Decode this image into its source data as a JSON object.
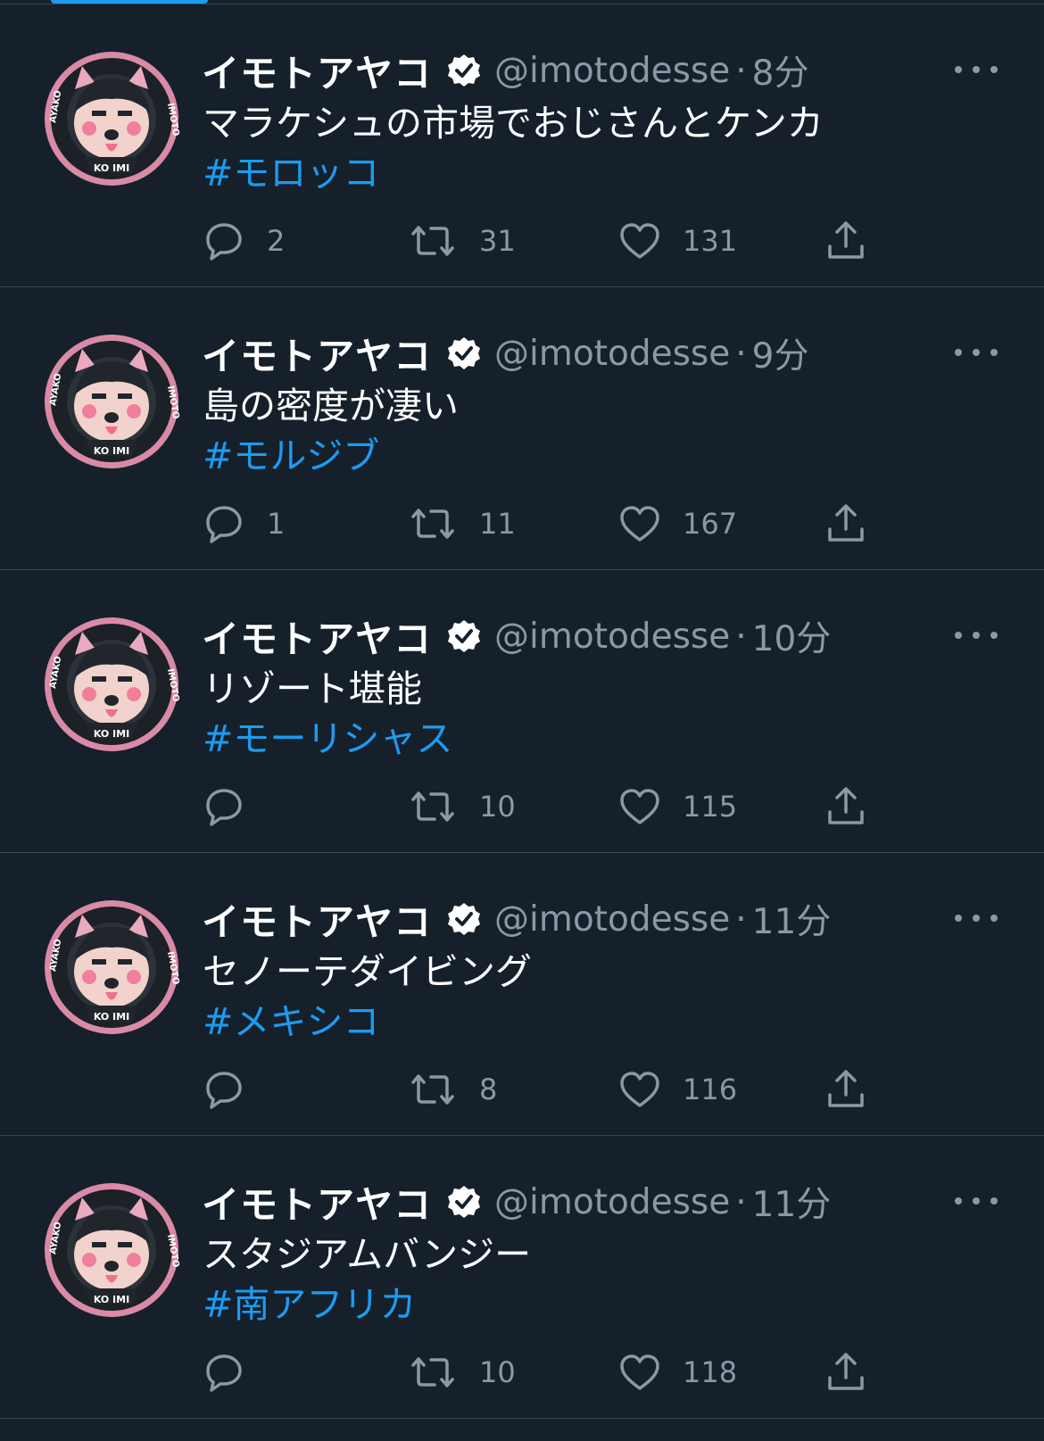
{
  "tweets": [
    {
      "name": "イモトアヤコ",
      "handle": "@imotodesse",
      "time": "8分",
      "text": "マラケシュの市場でおじさんとケンカ",
      "hashtag": "#モロッコ",
      "replies": "2",
      "retweets": "31",
      "likes": "131"
    },
    {
      "name": "イモトアヤコ",
      "handle": "@imotodesse",
      "time": "9分",
      "text": "島の密度が凄い",
      "hashtag": "#モルジブ",
      "replies": "1",
      "retweets": "11",
      "likes": "167"
    },
    {
      "name": "イモトアヤコ",
      "handle": "@imotodesse",
      "time": "10分",
      "text": "リゾート堪能",
      "hashtag": "#モーリシャス",
      "replies": "",
      "retweets": "10",
      "likes": "115"
    },
    {
      "name": "イモトアヤコ",
      "handle": "@imotodesse",
      "time": "11分",
      "text": "セノーテダイビング",
      "hashtag": "#メキシコ",
      "replies": "",
      "retweets": "8",
      "likes": "116"
    },
    {
      "name": "イモトアヤコ",
      "handle": "@imotodesse",
      "time": "11分",
      "text": "スタジアムバンジー",
      "hashtag": "#南アフリカ",
      "replies": "",
      "retweets": "10",
      "likes": "118"
    }
  ],
  "separator": "·",
  "avatar_ring_text": {
    "left": "AYAKO",
    "right": "IMOTO",
    "bottom": "KO IMI"
  },
  "icons": {
    "verified": "verified-badge-icon",
    "more": "more-options-icon",
    "reply": "reply-icon",
    "retweet": "retweet-icon",
    "like": "heart-icon",
    "share": "share-icon"
  },
  "colors": {
    "background": "#15202b",
    "accent": "#1d9bf0",
    "secondary_text": "#8b98a5",
    "divider": "#38444d"
  }
}
